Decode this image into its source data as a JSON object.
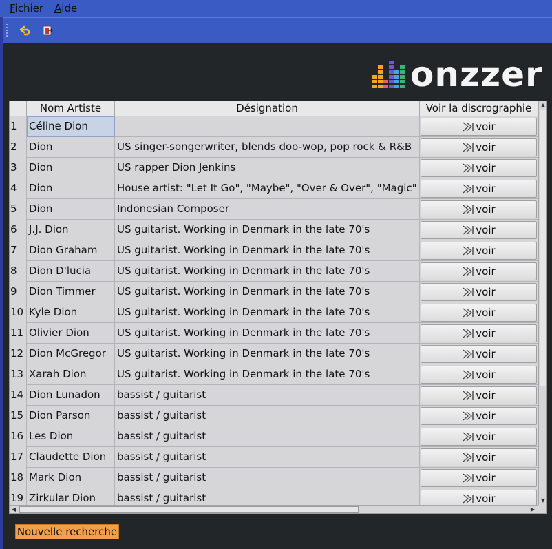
{
  "menu": [
    {
      "mnemonic": "F",
      "rest": "ichier"
    },
    {
      "mnemonic": "A",
      "rest": "ide"
    }
  ],
  "toolbar": {
    "icons": [
      "undo-icon",
      "exit-icon"
    ]
  },
  "logo": {
    "text": "onzzer",
    "bar_colors": [
      "#f4a623",
      "#f4a623",
      "#e85d75",
      "#6a5acd",
      "#4aa3df",
      "#3cb371"
    ]
  },
  "table": {
    "headers": [
      "Nom Artiste",
      "Désignation",
      "Voir la discrographie"
    ],
    "button_label": "voir",
    "rows": [
      {
        "num": "1",
        "artist": "Céline Dion",
        "designation": ""
      },
      {
        "num": "2",
        "artist": "Dion",
        "designation": "US singer-songerwriter, blends doo-wop, pop rock & R&B"
      },
      {
        "num": "3",
        "artist": "Dion",
        "designation": "US rapper Dion Jenkins"
      },
      {
        "num": "4",
        "artist": "Dion",
        "designation": "House artist: \"Let It Go\", \"Maybe\", \"Over & Over\", \"Magic\""
      },
      {
        "num": "5",
        "artist": "Dion",
        "designation": "Indonesian Composer"
      },
      {
        "num": "6",
        "artist": "J.J. Dion",
        "designation": "US guitarist. Working in Denmark in the late 70's"
      },
      {
        "num": "7",
        "artist": "Dion Graham",
        "designation": "US guitarist. Working in Denmark in the late 70's"
      },
      {
        "num": "8",
        "artist": "Dion D'lucia",
        "designation": "US guitarist. Working in Denmark in the late 70's"
      },
      {
        "num": "9",
        "artist": "Dion Timmer",
        "designation": "US guitarist. Working in Denmark in the late 70's"
      },
      {
        "num": "10",
        "artist": "Kyle Dion",
        "designation": "US guitarist. Working in Denmark in the late 70's"
      },
      {
        "num": "11",
        "artist": "Olivier Dion",
        "designation": "US guitarist. Working in Denmark in the late 70's"
      },
      {
        "num": "12",
        "artist": "Dion McGregor",
        "designation": "US guitarist. Working in Denmark in the late 70's"
      },
      {
        "num": "13",
        "artist": "Xarah Dion",
        "designation": "US guitarist. Working in Denmark in the late 70's"
      },
      {
        "num": "14",
        "artist": "Dion Lunadon",
        "designation": "bassist / guitarist"
      },
      {
        "num": "15",
        "artist": "Dion Parson",
        "designation": "bassist / guitarist"
      },
      {
        "num": "16",
        "artist": "Les Dion",
        "designation": "bassist / guitarist"
      },
      {
        "num": "17",
        "artist": "Claudette Dion",
        "designation": "bassist / guitarist"
      },
      {
        "num": "18",
        "artist": "Mark Dion",
        "designation": "bassist / guitarist"
      },
      {
        "num": "19",
        "artist": "Zirkular Dion",
        "designation": "bassist / guitarist"
      }
    ]
  },
  "footer": {
    "new_search_label": "Nouvelle recherche"
  }
}
